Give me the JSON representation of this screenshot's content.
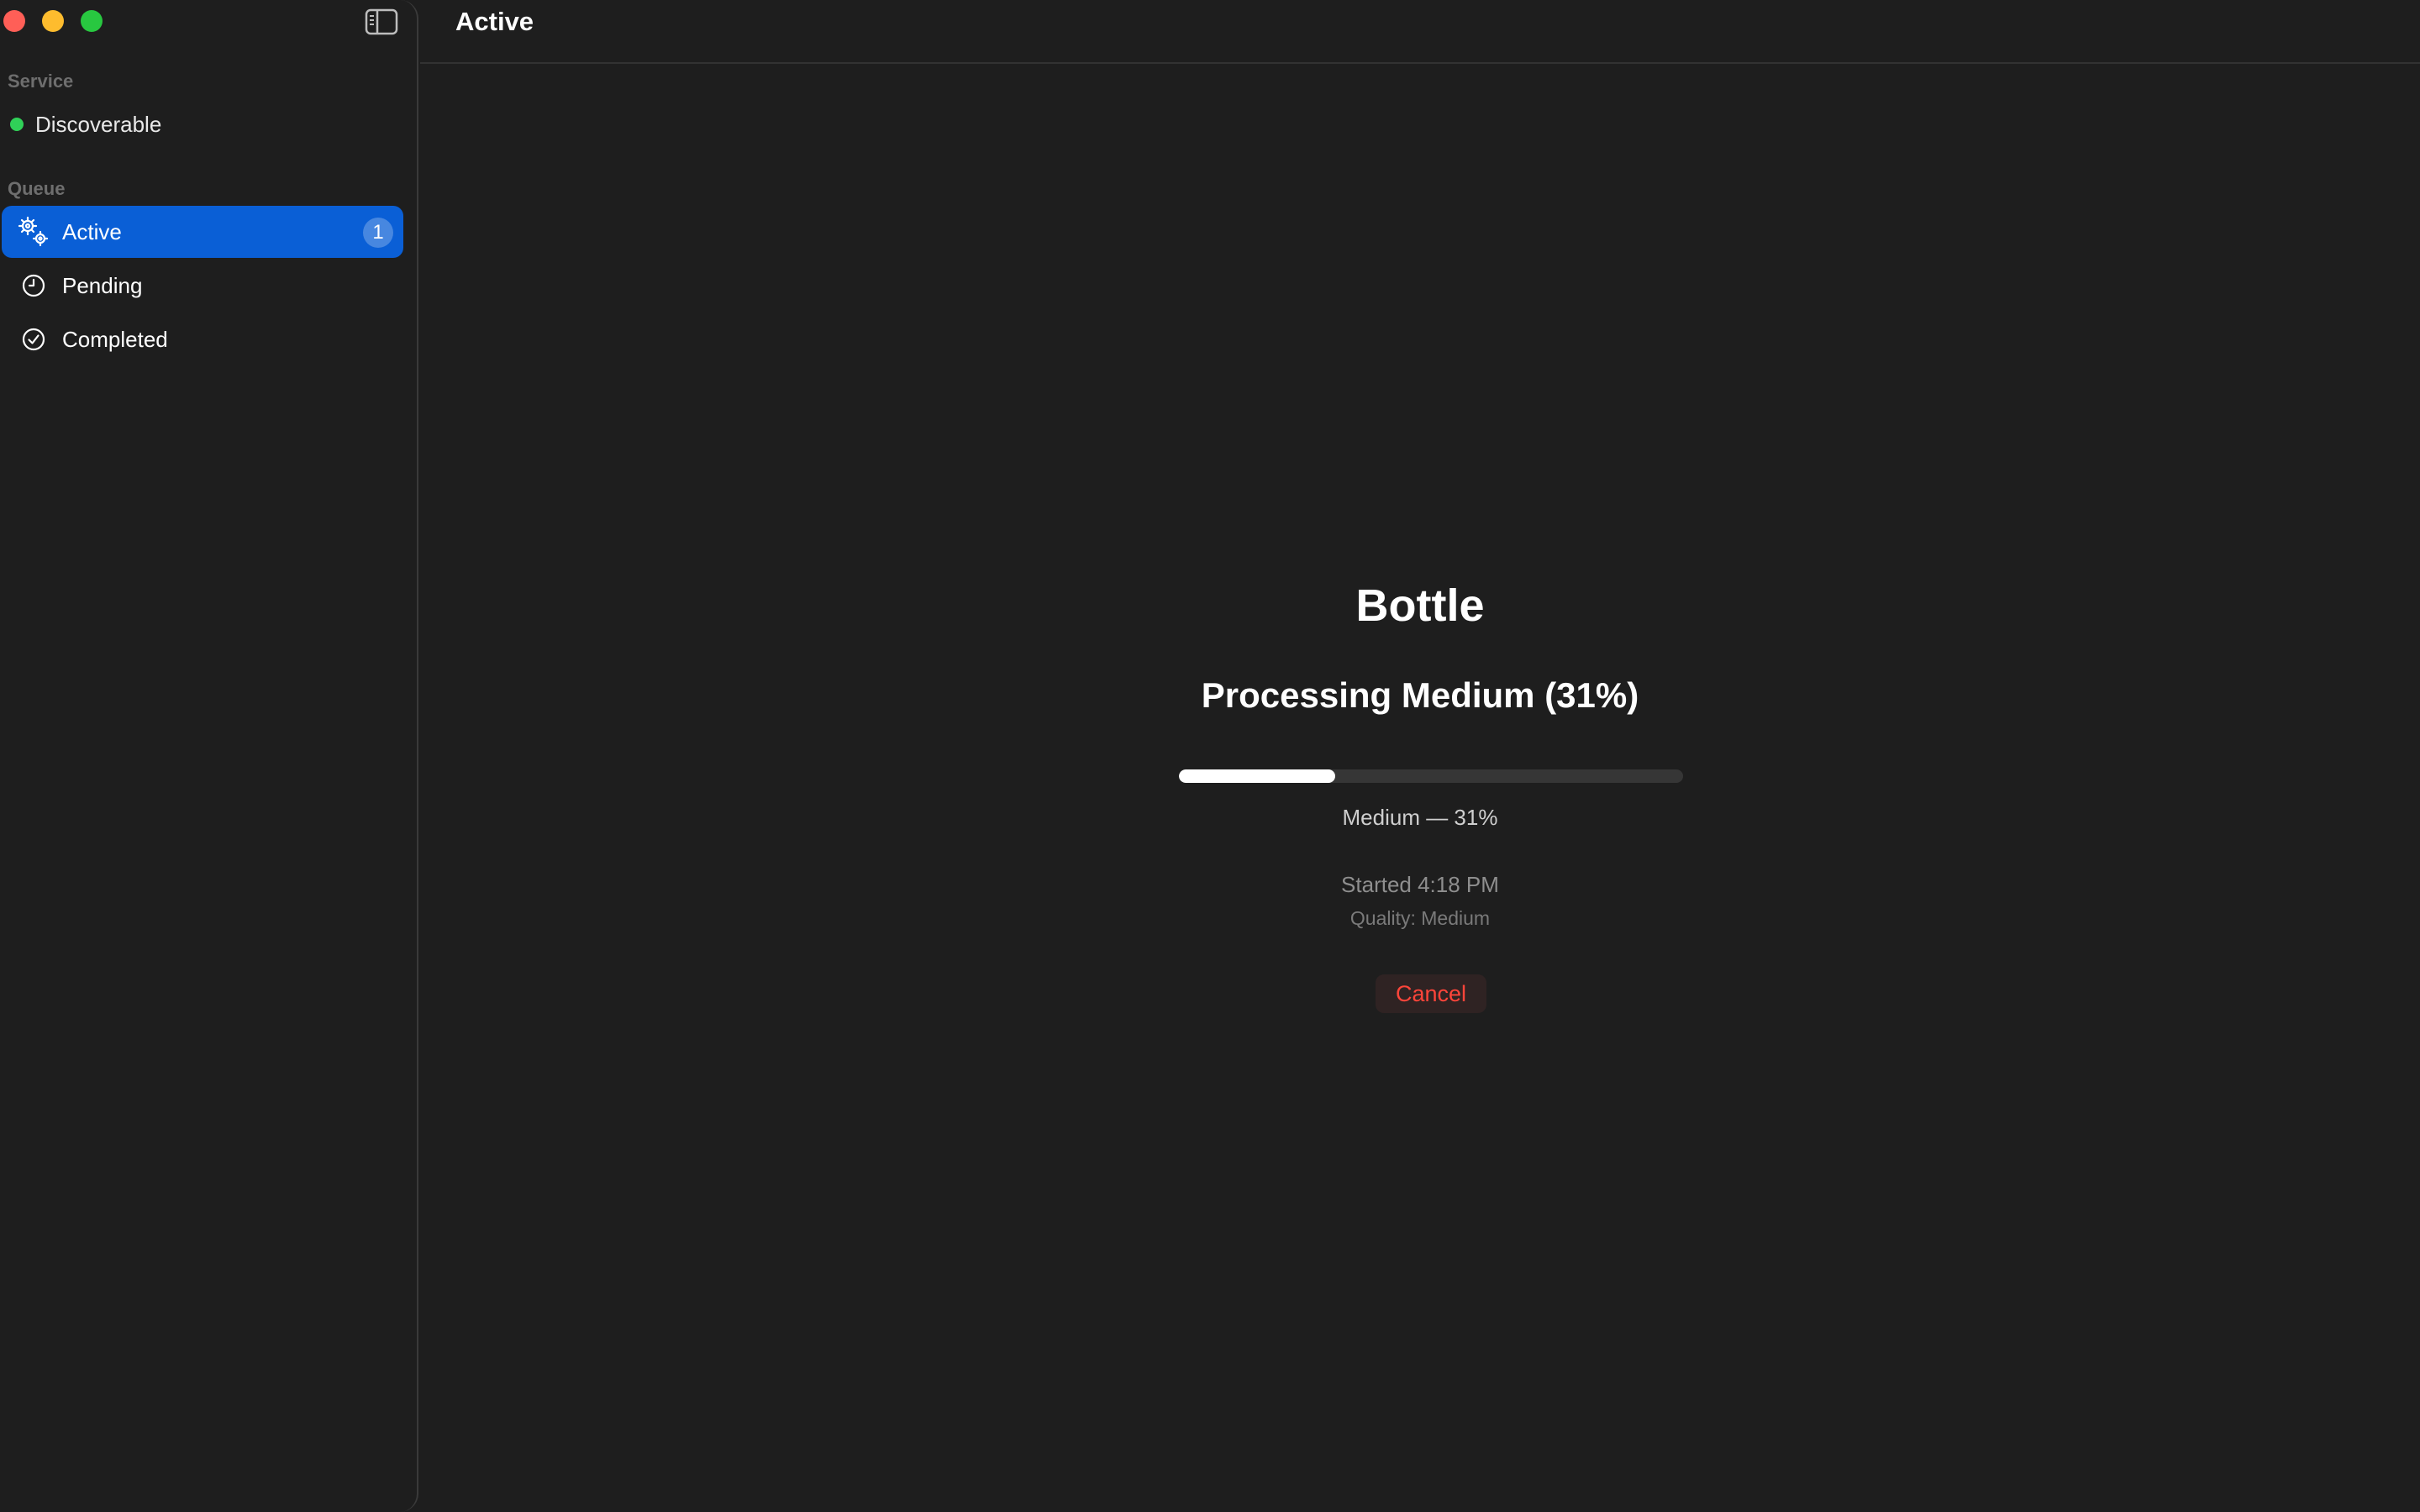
{
  "window": {
    "controls": [
      "close",
      "minimize",
      "maximize"
    ]
  },
  "sidebar": {
    "toggle_icon": "sidebar-toggle-icon",
    "sections": [
      {
        "label": "Service"
      },
      {
        "label": "Queue"
      }
    ],
    "service_status": {
      "label": "Discoverable",
      "color": "#30d158"
    },
    "items": [
      {
        "label": "Active",
        "icon": "gears-icon",
        "badge": "1",
        "selected": true
      },
      {
        "label": "Pending",
        "icon": "clock-icon",
        "selected": false
      },
      {
        "label": "Completed",
        "icon": "checkmark-circle-icon",
        "selected": false
      }
    ]
  },
  "header": {
    "title": "Active"
  },
  "job": {
    "name": "Bottle",
    "status": "Processing Medium (31%)",
    "progress": 0.31,
    "progress_caption": "Medium — 31%",
    "started": "Started 4:18 PM",
    "quality": "Quality: Medium",
    "cancel_label": "Cancel"
  },
  "colors": {
    "accent": "#0a5fd6",
    "danger": "#ff453a",
    "status_ok": "#30d158"
  }
}
